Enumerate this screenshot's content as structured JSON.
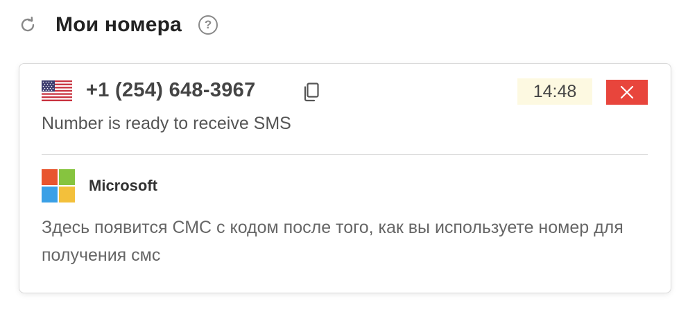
{
  "header": {
    "title": "Мои номера",
    "help_label": "?"
  },
  "number_card": {
    "country_icon": "us-flag-icon",
    "phone": "+1 (254) 648-3967",
    "timer": "14:48",
    "status": "Number is ready to receive SMS",
    "service": {
      "name": "Microsoft",
      "icon": "microsoft-logo-icon"
    },
    "sms_placeholder": "Здесь появится СМС с кодом после того, как вы используете номер для получения смс"
  },
  "colors": {
    "close_button": "#e8453c",
    "timer_bg": "#fdf9e1",
    "ms_red": "#e8552e",
    "ms_green": "#86c43f",
    "ms_blue": "#3aa0e6",
    "ms_yellow": "#f3c03b"
  }
}
